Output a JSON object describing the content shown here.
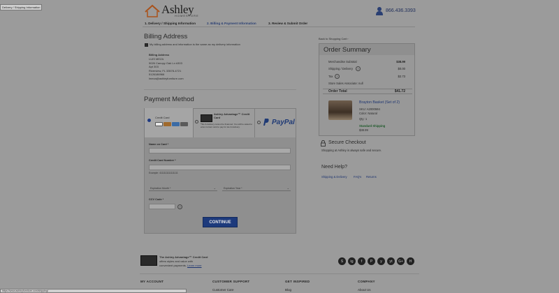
{
  "tooltip": "Delivery / Shipping Information",
  "brand": {
    "name": "Ashley",
    "sub": "HOMESTORE"
  },
  "phone": "866.436.3393",
  "steps": [
    {
      "label": "1. Delivery / Shipping Information"
    },
    {
      "label": "2. Billing & Payment Information"
    },
    {
      "label": "3. Review & Submit Order"
    }
  ],
  "billing": {
    "title": "Billing Address",
    "same_as_delivery": "My billing address and information is the same as my delivery information",
    "address_heading": "Billing Address",
    "lines": [
      "LUIS MEZA",
      "9026 Canopy Oak Ln #303",
      "Apt 303",
      "Riverview, FL 33578-4721",
      "5126186966",
      "lmeza@ashleyfurniture.com"
    ]
  },
  "payment": {
    "title": "Payment Method",
    "credit_card": "Credit Card",
    "ashley_card_title": "Ashley Advantage™ Credit Card",
    "ashley_card_note": "*Tax & delivery cannot be financed. You will be asked to enter current card to pay for tax & delivery.",
    "paypal": "PayPal",
    "name_label": "Name on Card",
    "number_label": "Credit Card Number",
    "example": "Example: 4111111111111111",
    "exp_month": "Expiration Month *",
    "exp_year": "Expiration Year *",
    "cvv_label": "CCV Code",
    "continue": "CONTINUE"
  },
  "summary": {
    "back_link": "Back to Shopping Cart ›",
    "title": "Order Summary",
    "subtotal_label": "Merchandise Subtotal",
    "subtotal": "$38.99",
    "shipping_label": "Shipping / Delivery",
    "shipping": "$0.00",
    "tax_label": "Tax",
    "tax": "$2.73",
    "associate": "Store Sales Associate: null",
    "total_label": "Order Total",
    "total": "$41.72",
    "product": {
      "name": "Brayton Basket (Set of 2)",
      "sku": "SKU: A2000594",
      "color": "Color: Natural",
      "qty": "Qty: 1",
      "shipping": "Standard Shipping",
      "price": "$38.99"
    }
  },
  "secure": {
    "title": "Secure Checkout",
    "text": "Shopping at Ashley is always safe and secure."
  },
  "help": {
    "title": "Need Help?",
    "links": [
      "Shipping & Delivery",
      "FAQ's",
      "Returns"
    ]
  },
  "footer": {
    "card_title": "The Ashley Advantage™ Credit Card",
    "card_text_1": "offers styles and value with",
    "card_text_2": "convenient payments.",
    "learn_more": "Learn more",
    "social": [
      "S",
      "ig",
      "f",
      "P",
      "y",
      "yt",
      "G+",
      "H"
    ],
    "columns": [
      {
        "head": "MY ACCOUNT",
        "link": ""
      },
      {
        "head": "CUSTOMER SUPPORT",
        "link": "Customer Care"
      },
      {
        "head": "GET INSPIRED",
        "link": "Blog"
      },
      {
        "head": "COMPANY",
        "link": "About Us"
      }
    ]
  },
  "status_url": "https://www.ashleyfurniture.com/shipping/"
}
